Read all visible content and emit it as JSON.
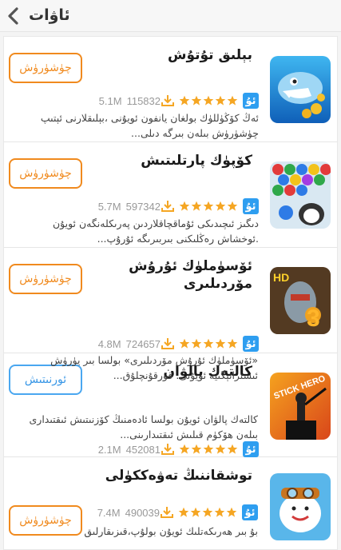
{
  "header": {
    "title": "ئاۋات"
  },
  "apps": [
    {
      "title": "بېلىق تۇتۇش",
      "size": "5.1M",
      "downloads": "115832",
      "badge": "ئۇ",
      "rating": 5,
      "desc": "ئەڭ كۆڭۈللۈك بولغان يانفون ئويۇنى ،بېلىقلارنى ئېتىپ چۈشۈرۈش بىلەن بىرگە دىلى...",
      "button": "چۈشۈرۈش",
      "button_style": "orange"
    },
    {
      "title": "كۆپۈك پارتلىتىش",
      "size": "5.7M",
      "downloads": "597342",
      "badge": "ئۇ",
      "rating": 5,
      "desc": "دىگىز ئىچىدىكى ئۇماقچاقلاردىن پەرىكلەنگەن ئويۇن .ئوخشاش رەڭلىكنى بىربىرىگە ئۇرۇپ...",
      "button": "چۈشۈرۈش",
      "button_style": "orange"
    },
    {
      "title": "ئۆسۈملۈك ئۇرۇش مۆردىلىرى",
      "size": "4.8M",
      "downloads": "724657",
      "badge": "ئۇ",
      "rating": 5,
      "desc": "«ئۆسۈملۈك ئۇرۇش مۆردىلىرى» بولسا بىر يۈرۈش ئىستراتېگىيە ئويۇنى. قورقۇنچلۇق...",
      "button": "چۈشۈرۈش",
      "button_style": "orange"
    },
    {
      "title": "كالتەك پالۋان",
      "size": "2.1M",
      "downloads": "452081",
      "badge": "ئۇ",
      "rating": 5,
      "desc": "كالتەك پالۋان ئويۇن بولسا ئادەمنىڭ كۆزنىتىش ئىقتىدارى بىلەن ھۆكۈم قىلىش ئىقتىدارىنى...",
      "button": "ئورنىتىش",
      "button_style": "blue"
    },
    {
      "title": "توشقاننىڭ تەۋەككۈلى",
      "size": "7.4M",
      "downloads": "490039",
      "badge": "ئۇ",
      "rating": 5,
      "desc": "بۇ بىر ھەرىكەتلىك ئويۇن بولۇپ،قىزىقارلىق",
      "button": "چۈشۈرۈش",
      "button_style": "orange"
    }
  ],
  "colors": {
    "accent_orange": "#f08a1e",
    "accent_blue": "#3796e6",
    "badge_blue": "#2e9ef0",
    "star": "#f5a623"
  },
  "icons": {
    "back": "chevron-left-icon",
    "download": "download-icon",
    "star": "star-icon"
  }
}
